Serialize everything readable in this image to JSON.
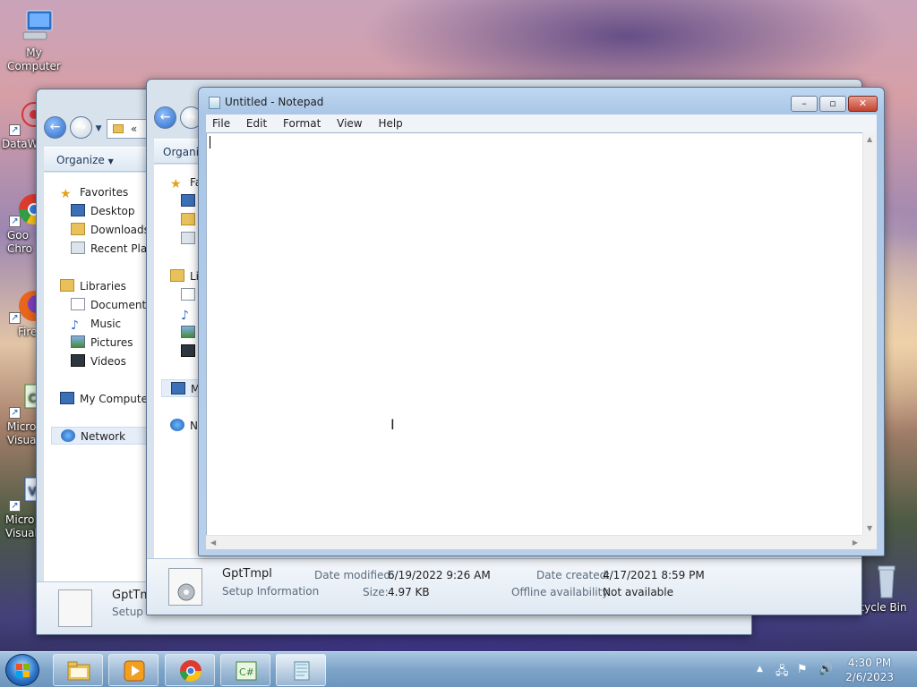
{
  "desktop": {
    "icons": [
      {
        "label": "My Computer",
        "icon": "computer-icon"
      },
      {
        "label": "DataWa",
        "icon": "datawarrior-icon"
      },
      {
        "label": "Goo Chro",
        "icon": "chrome-icon"
      },
      {
        "label": "Fire",
        "icon": "firefox-icon"
      },
      {
        "label": "Micro Visual",
        "icon": "visual-studio-csharp-icon"
      },
      {
        "label": "Micro Visual",
        "icon": "visual-studio-vb-icon"
      },
      {
        "label": "Recycle Bin",
        "icon": "recycle-bin-icon"
      }
    ]
  },
  "explorer_back": {
    "address": "«",
    "organize_label": "Organize",
    "favorites": {
      "header": "Favorites",
      "items": [
        "Desktop",
        "Downloads",
        "Recent Places"
      ]
    },
    "libraries": {
      "header": "Libraries",
      "items": [
        "Documents",
        "Music",
        "Pictures",
        "Videos"
      ]
    },
    "computer_label": "My Computer",
    "network_label": "Network",
    "file_name": "GptTm",
    "file_type": "Setup In"
  },
  "explorer_front": {
    "organize_label": "Organi",
    "nav_initials": [
      "Fa",
      "Li",
      "M",
      "N"
    ]
  },
  "details": {
    "file_name": "GptTmpl",
    "file_type": "Setup Information",
    "date_modified_label": "Date modified:",
    "date_modified": "6/19/2022 9:26 AM",
    "size_label": "Size:",
    "size": "4.97 KB",
    "date_created_label": "Date created:",
    "date_created": "4/17/2021 8:59 PM",
    "offline_label": "Offline availability:",
    "offline": "Not available"
  },
  "notepad": {
    "title": "Untitled - Notepad",
    "menus": [
      "File",
      "Edit",
      "Format",
      "View",
      "Help"
    ],
    "content": "",
    "controls": {
      "minimize": "–",
      "maximize": "▫",
      "close": "✕"
    }
  },
  "taskbar": {
    "apps": [
      {
        "name": "Windows Explorer",
        "icon": "folder-icon",
        "active": false
      },
      {
        "name": "Media Player",
        "icon": "media-player-icon",
        "active": false
      },
      {
        "name": "Google Chrome",
        "icon": "chrome-icon",
        "active": false
      },
      {
        "name": "Visual Studio C#",
        "icon": "visual-studio-csharp-icon",
        "active": false
      },
      {
        "name": "Notepad",
        "icon": "notepad-icon",
        "active": true
      }
    ],
    "time": "4:30 PM",
    "date": "2/6/2023"
  }
}
